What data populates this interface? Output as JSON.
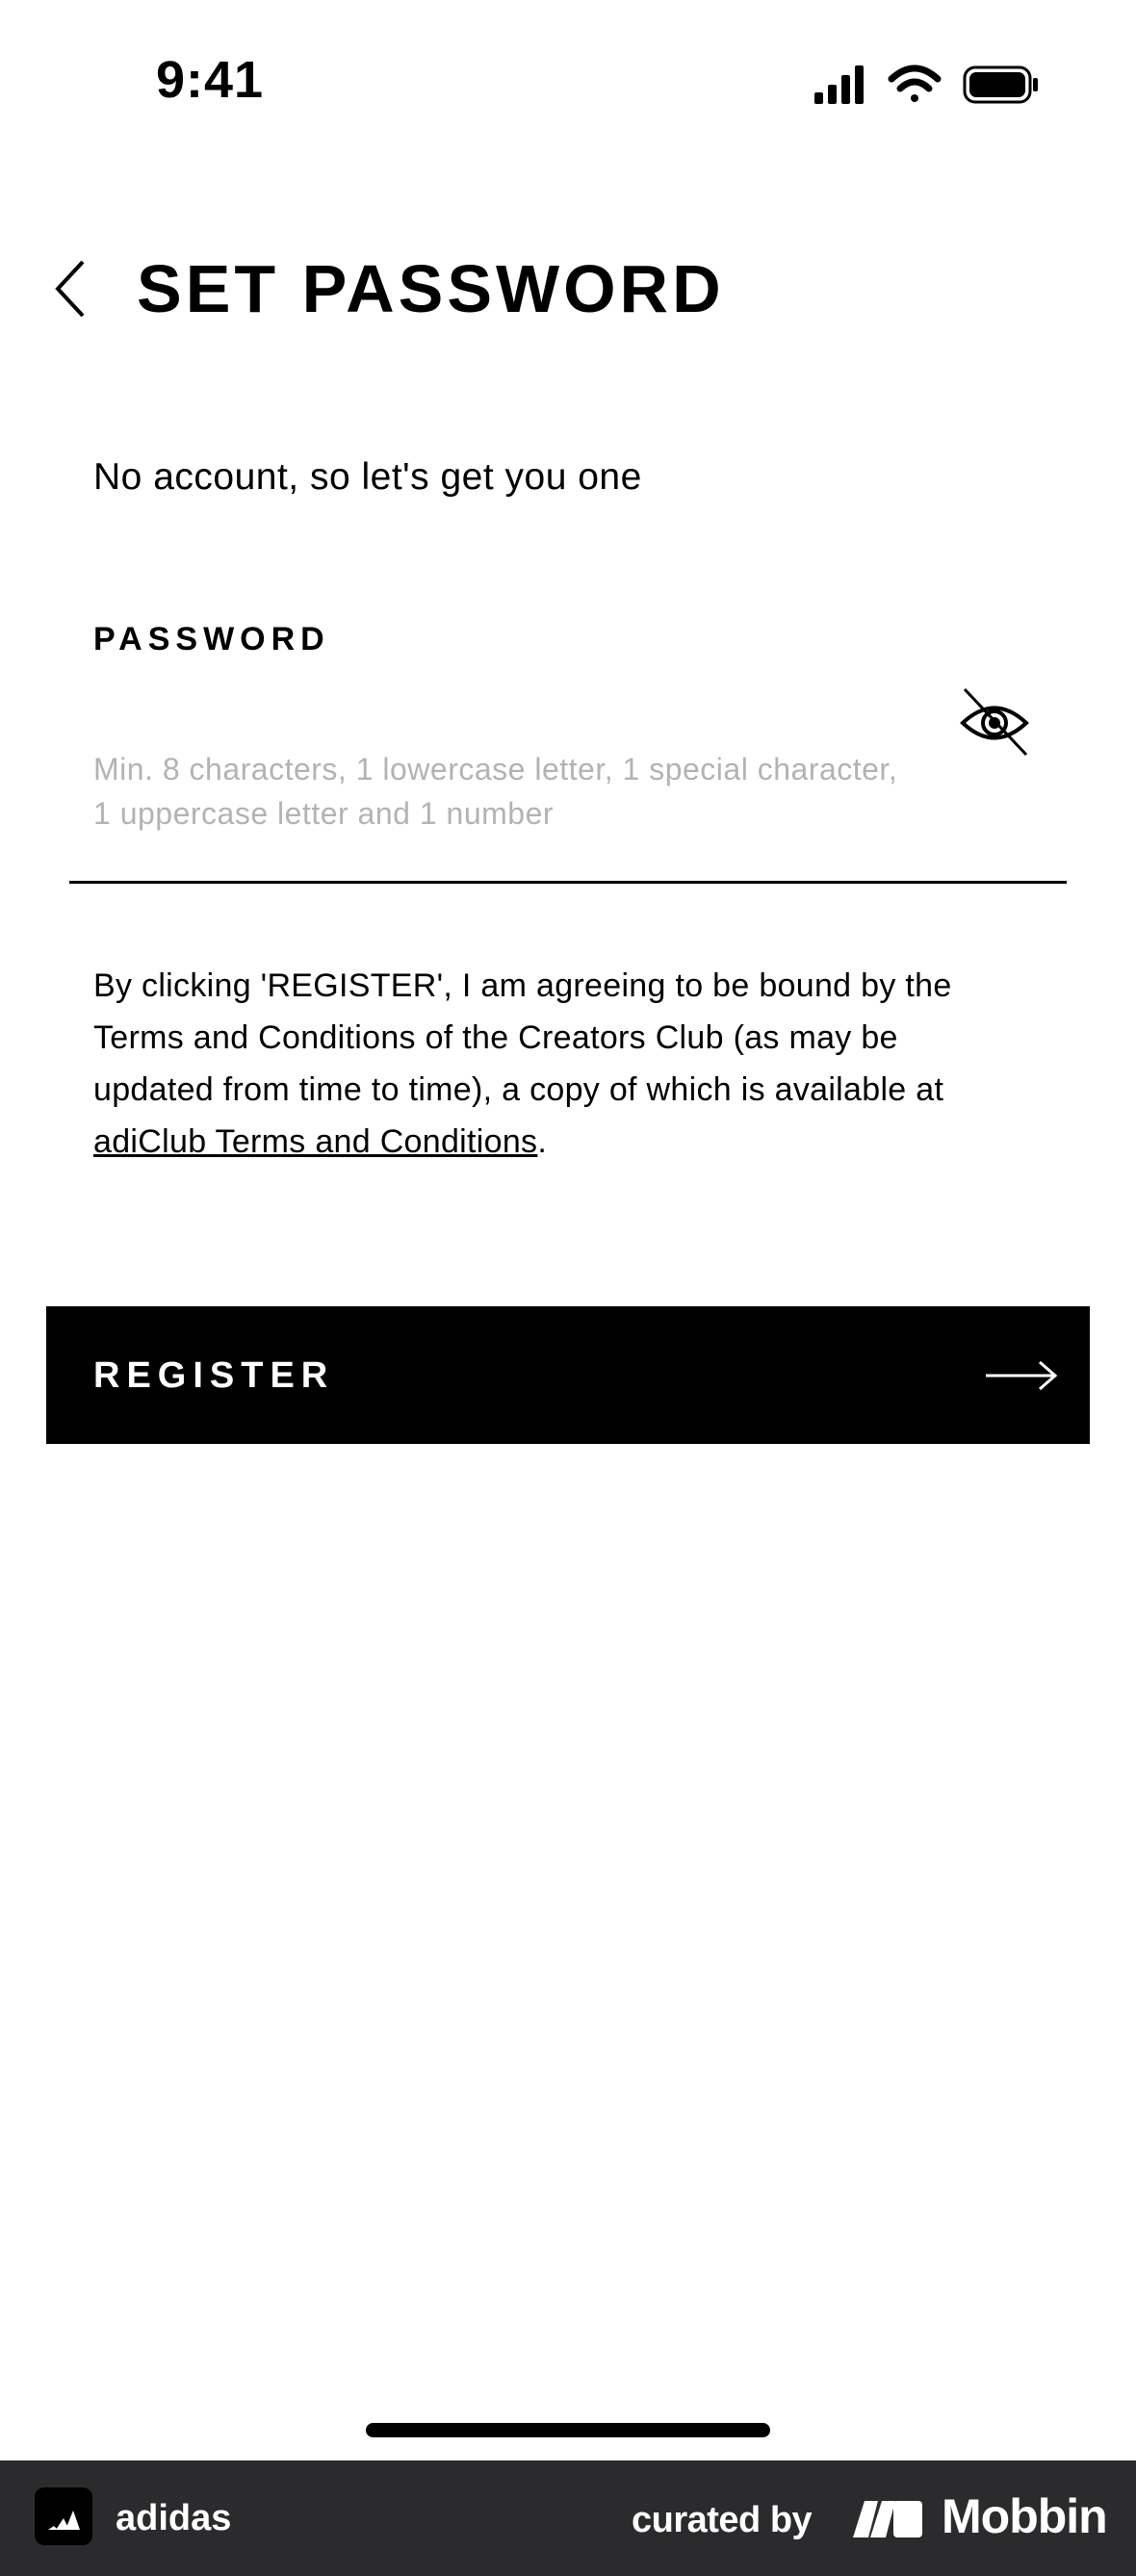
{
  "status_bar": {
    "time": "9:41",
    "icons": [
      "signal-icon",
      "wifi-icon",
      "battery-icon"
    ]
  },
  "header": {
    "back_icon": "chevron-left-icon",
    "title": "SET PASSWORD"
  },
  "main": {
    "subtitle": "No account, so let's get you one",
    "password": {
      "label": "PASSWORD",
      "value": "",
      "placeholder": "Min. 8 characters, 1 lowercase letter, 1 special character, 1 uppercase letter and 1 number",
      "toggle_icon": "eye-off-icon"
    },
    "terms": {
      "text": "By clicking 'REGISTER', I am agreeing to be bound by the Terms and Conditions of the Creators Club (as may be updated from time to time), a copy of which is available at ",
      "link_text": "adiClub Terms and Conditions",
      "suffix": "."
    },
    "register": {
      "label": "REGISTER",
      "icon": "arrow-right-icon"
    }
  },
  "footer": {
    "app_name": "adidas",
    "curated_by": "curated by",
    "brand": "Mobbin"
  },
  "colors": {
    "primary": "#000000",
    "background": "#ffffff",
    "placeholder": "#b3b3b3",
    "footer_bg": "#2b2b2d",
    "footer_text": "#ffffff"
  }
}
